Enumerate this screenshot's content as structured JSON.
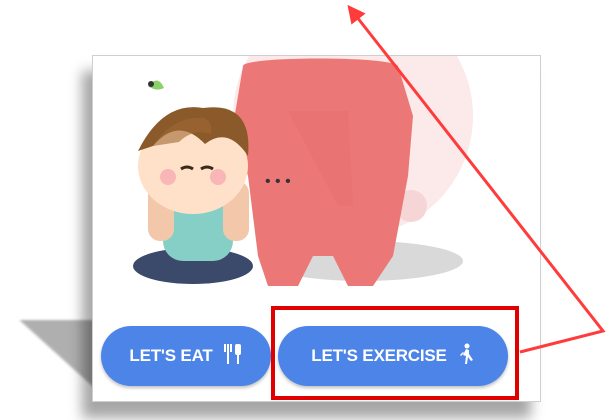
{
  "buttons": {
    "eat": {
      "label": "LET'S EAT",
      "icon": "fork-knife-icon"
    },
    "exercise": {
      "label": "LET'S EXERCISE",
      "icon": "walking-person-icon"
    }
  },
  "illustration": {
    "thought_dots": "• • •"
  },
  "colors": {
    "button_blue": "#4c84e8",
    "highlight_red": "#e00000",
    "arrow_red": "#ff3b3b",
    "body_pink": "#ec7777"
  }
}
